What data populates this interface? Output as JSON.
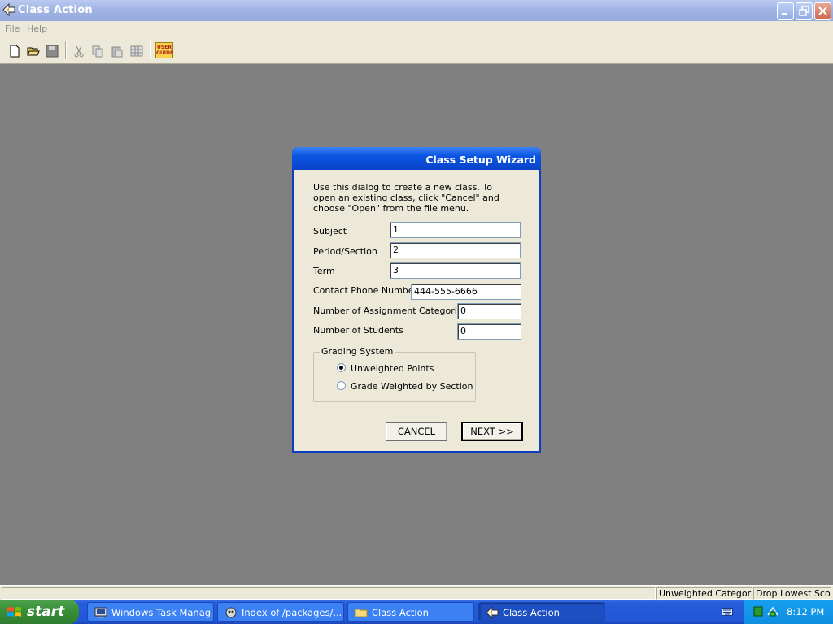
{
  "window": {
    "title": "Class Action",
    "icon": "class-action-icon",
    "controls": [
      "minimize-icon",
      "restore-icon",
      "close-icon"
    ]
  },
  "menu": {
    "file": "File",
    "help": "Help"
  },
  "toolbar": {
    "buttons": [
      "new-icon",
      "open-icon",
      "save-icon",
      "cut-icon",
      "copy-icon",
      "paste-icon",
      "table-icon"
    ],
    "user_guide_line1": "USER",
    "user_guide_line2": "GUIDE"
  },
  "dialog": {
    "title": "Class Setup Wizard",
    "intro": "Use this dialog to create a new class. To open an existing class, click \"Cancel\" and choose \"Open\" from the file menu.",
    "fields": {
      "subject": {
        "label": "Subject",
        "value": "1"
      },
      "period": {
        "label": "Period/Section",
        "value": "2"
      },
      "term": {
        "label": "Term",
        "value": "3"
      },
      "phone": {
        "label": "Contact Phone Number",
        "value": "444-555-6666"
      },
      "categories": {
        "label": "Number of Assignment Categories",
        "value": "0"
      },
      "students": {
        "label": "Number of Students",
        "value": "0"
      }
    },
    "grading": {
      "legend": "Grading System",
      "options": [
        {
          "label": "Unweighted Points",
          "selected": true
        },
        {
          "label": "Grade Weighted by Section",
          "selected": false
        }
      ]
    },
    "cancel": "CANCEL",
    "next": "NEXT >>"
  },
  "statusbar": {
    "pane1": "Unweighted Categories",
    "pane2": "Drop Lowest Score"
  },
  "taskbar": {
    "start": "start",
    "tasks": [
      {
        "label": "Windows Task Manager",
        "icon": "task-manager-icon"
      },
      {
        "label": "Index of /packages/...",
        "icon": "browser-icon"
      },
      {
        "label": "Class Action",
        "icon": "folder-icon"
      },
      {
        "label": "Class Action",
        "icon": "class-action-icon"
      }
    ],
    "clock": "8:12 PM"
  }
}
